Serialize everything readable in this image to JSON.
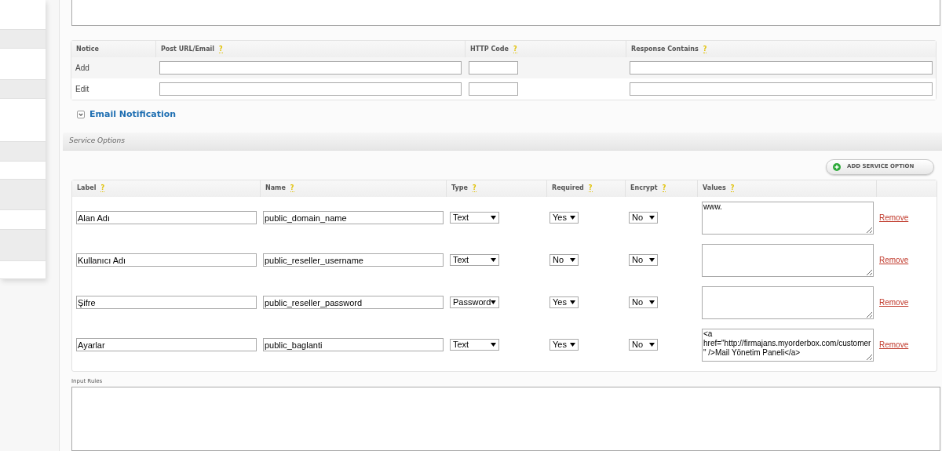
{
  "notice_table": {
    "columns": [
      {
        "label": "Notice"
      },
      {
        "label": "Post URL/Email",
        "help": "?"
      },
      {
        "label": "HTTP Code",
        "help": "?"
      },
      {
        "label": "Response Contains",
        "help": "?"
      }
    ],
    "rows": [
      {
        "label": "Add"
      },
      {
        "label": "Edit"
      }
    ]
  },
  "email_notification": {
    "label": "Email Notification"
  },
  "service_options": {
    "title": "Service Options",
    "add_button": "ADD SERVICE OPTION",
    "columns": [
      {
        "label": "Label",
        "help": "?"
      },
      {
        "label": "Name",
        "help": "?"
      },
      {
        "label": "Type",
        "help": "?"
      },
      {
        "label": "Required",
        "help": "?"
      },
      {
        "label": "Encrypt",
        "help": "?"
      },
      {
        "label": "Values",
        "help": "?"
      }
    ],
    "rows": [
      {
        "label": "Alan Adı",
        "name": "public_domain_name",
        "type": "Text",
        "required": "Yes",
        "encrypt": "No",
        "values": "www.",
        "action": "Remove"
      },
      {
        "label": "Kullanıcı Adı",
        "name": "public_reseller_username",
        "type": "Text",
        "required": "No",
        "encrypt": "No",
        "values": "",
        "action": "Remove"
      },
      {
        "label": "Şifre",
        "name": "public_reseller_password",
        "type": "Password",
        "required": "Yes",
        "encrypt": "No",
        "values": "",
        "action": "Remove"
      },
      {
        "label": "Ayarlar",
        "name": "public_baglanti",
        "type": "Text",
        "required": "Yes",
        "encrypt": "No",
        "values": "<a href=\"http://firmajans.myorderbox.com/customer\" />Mail Yönetim Paneli</a>",
        "action": "Remove"
      }
    ]
  },
  "input_rules": {
    "label": "Input Rules"
  }
}
